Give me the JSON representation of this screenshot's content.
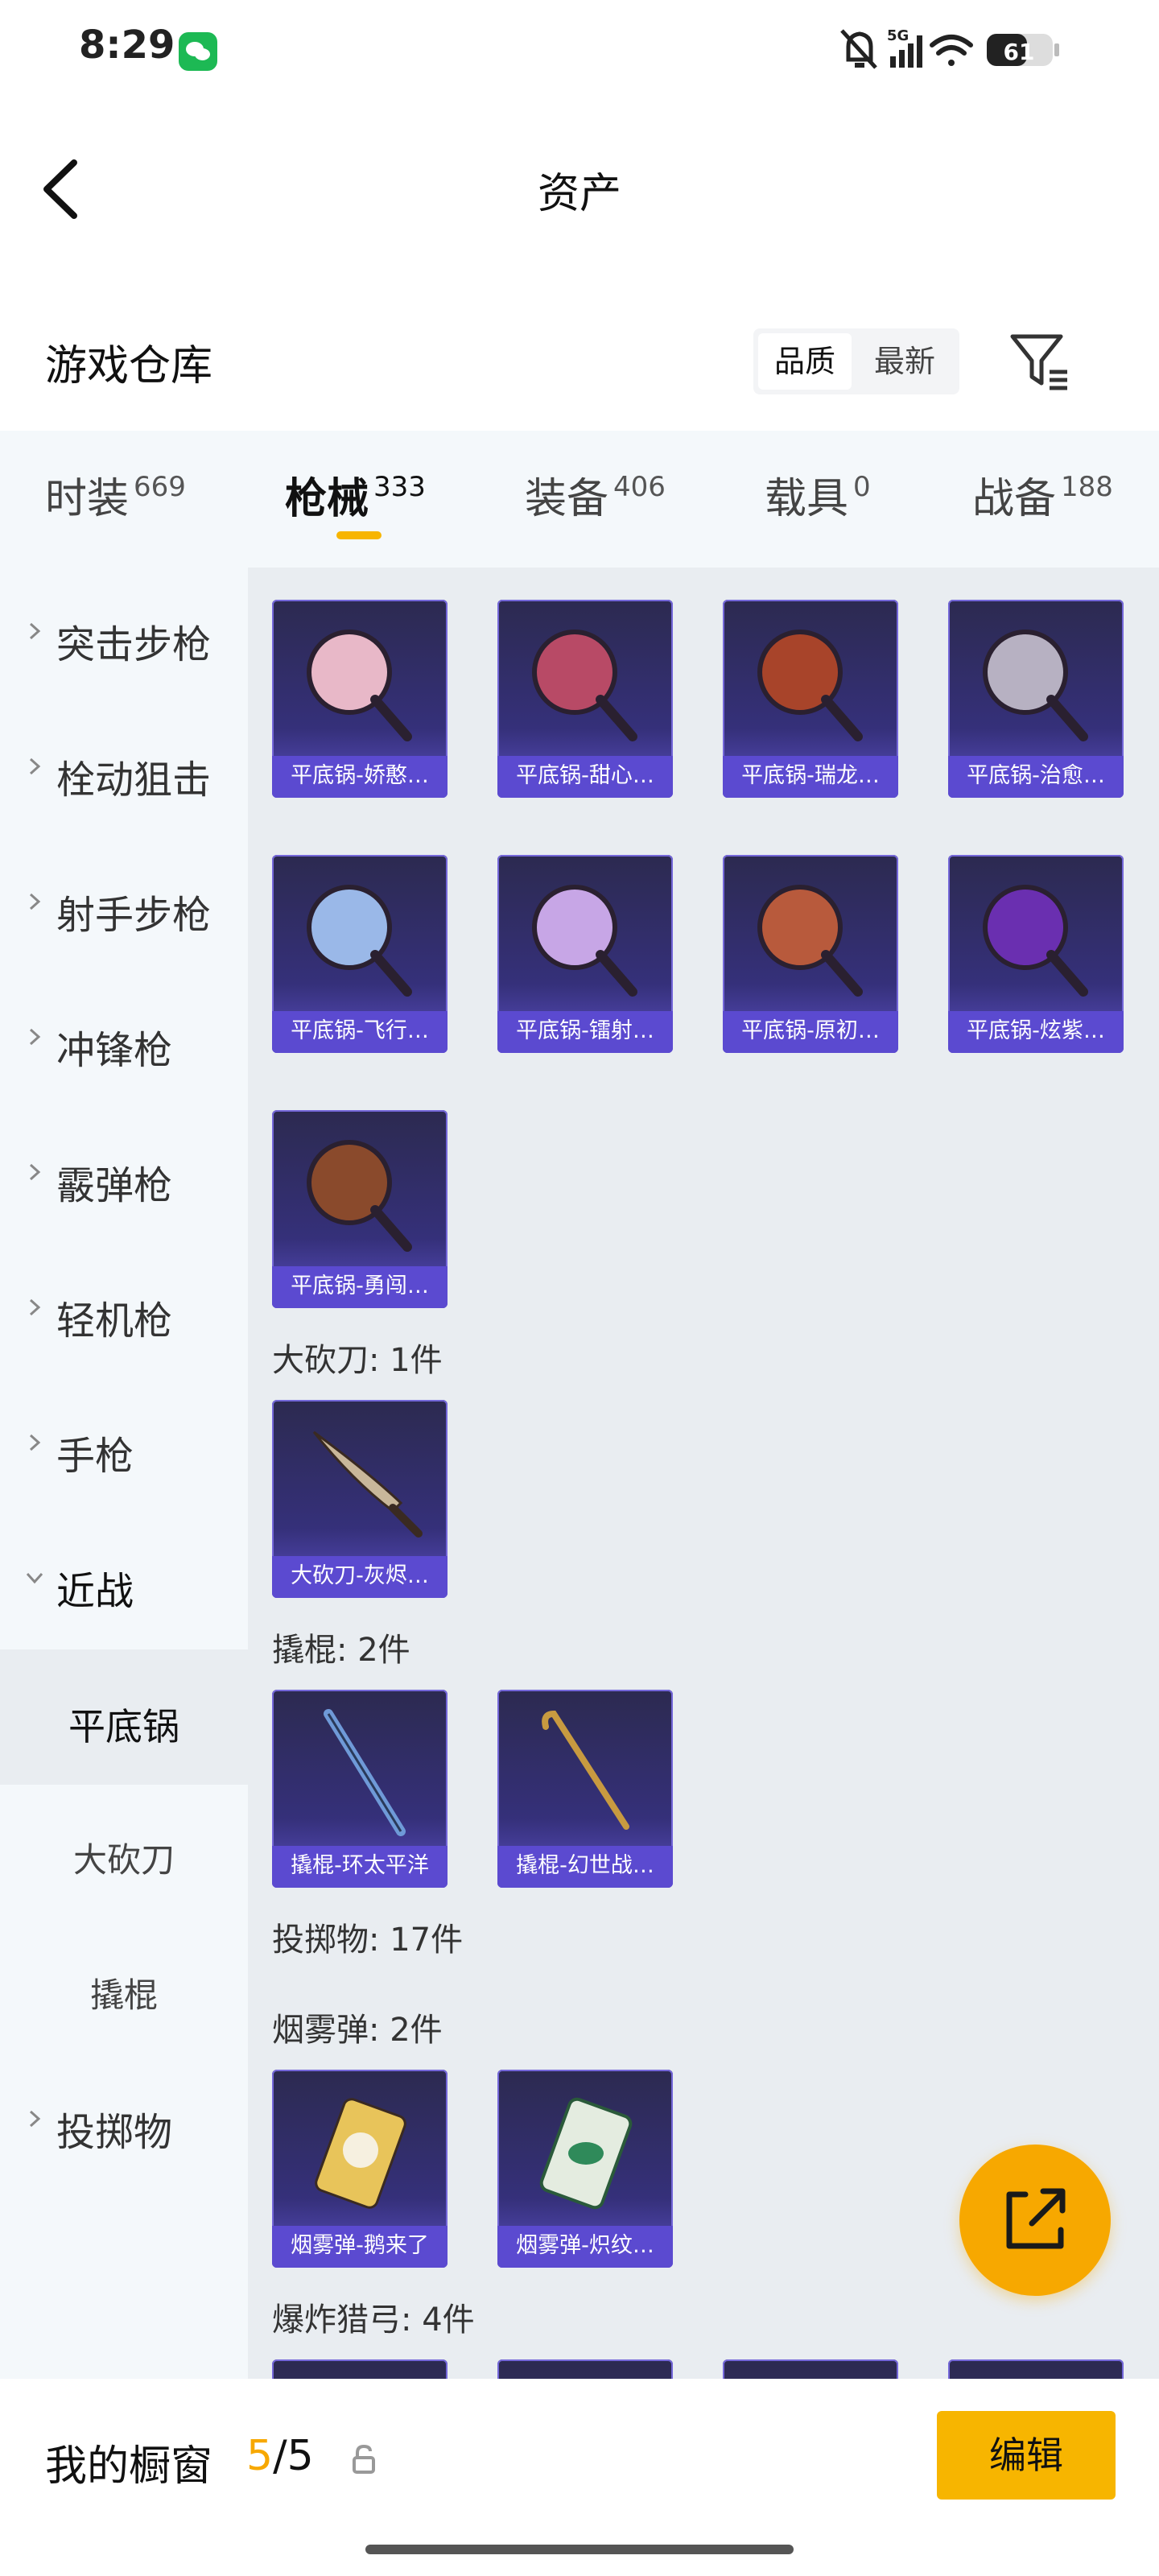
{
  "status_bar": {
    "time": "8:29",
    "network": "5G",
    "battery": "61"
  },
  "header": {
    "title": "资产"
  },
  "warehouse": {
    "title": "游戏仓库",
    "sort_quality": "品质",
    "sort_newest": "最新"
  },
  "tabs": [
    {
      "label": "时装",
      "count": "669"
    },
    {
      "label": "枪械",
      "count": "333"
    },
    {
      "label": "装备",
      "count": "406"
    },
    {
      "label": "载具",
      "count": "0"
    },
    {
      "label": "战备",
      "count": "188"
    }
  ],
  "sidebar": {
    "items": [
      {
        "label": "突击步枪"
      },
      {
        "label": "栓动狙击"
      },
      {
        "label": "射手步枪"
      },
      {
        "label": "冲锋枪"
      },
      {
        "label": "霰弹枪"
      },
      {
        "label": "轻机枪"
      },
      {
        "label": "手枪"
      },
      {
        "label": "近战"
      }
    ],
    "sub_items": [
      {
        "label": "平底锅"
      },
      {
        "label": "大砍刀"
      },
      {
        "label": "撬棍"
      }
    ],
    "after": {
      "label": "投掷物"
    }
  },
  "content": {
    "pans": [
      {
        "label": "平底锅-娇憨…",
        "color": "#e8b8c8"
      },
      {
        "label": "平底锅-甜心…",
        "color": "#b84a66"
      },
      {
        "label": "平底锅-瑞龙…",
        "color": "#a8442a"
      },
      {
        "label": "平底锅-治愈…",
        "color": "#b7b1c2"
      },
      {
        "label": "平底锅-飞行…",
        "color": "#9ab8e8"
      },
      {
        "label": "平底锅-镭射…",
        "color": "#c7a6e6"
      },
      {
        "label": "平底锅-原初…",
        "color": "#b85a3c"
      },
      {
        "label": "平底锅-炫紫…",
        "color": "#6a2fb0"
      },
      {
        "label": "平底锅-勇闯…",
        "color": "#8a4a2c"
      }
    ],
    "machete_header": "大砍刀: 1件",
    "machetes": [
      {
        "label": "大砍刀-灰烬…"
      }
    ],
    "crowbar_header": "撬棍: 2件",
    "crowbars": [
      {
        "label": "撬棍-环太平洋"
      },
      {
        "label": "撬棍-幻世战…"
      }
    ],
    "throwables_header": "投掷物: 17件",
    "smoke_header": "烟雾弹: 2件",
    "smokes": [
      {
        "label": "烟雾弹-鹅来了"
      },
      {
        "label": "烟雾弹-炽纹…"
      }
    ],
    "bow_header": "爆炸猎弓: 4件"
  },
  "bottom_bar": {
    "label": "我的橱窗",
    "count_current": "5",
    "count_total": "/5",
    "edit_label": "编辑"
  }
}
